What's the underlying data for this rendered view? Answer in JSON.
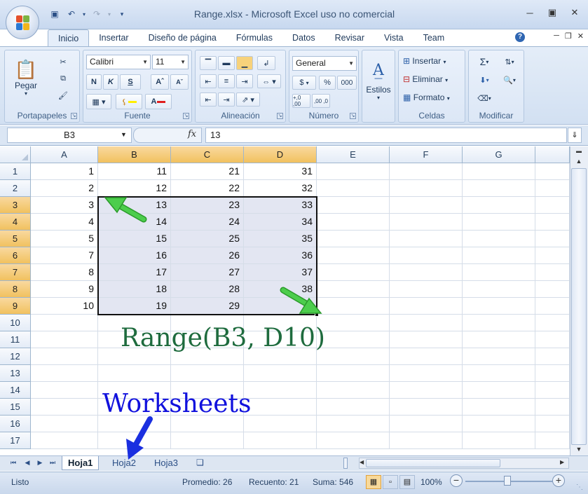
{
  "window": {
    "title": "Range.xlsx - Microsoft Excel uso no comercial"
  },
  "ribbon_tabs": [
    "Inicio",
    "Insertar",
    "Diseño de página",
    "Fórmulas",
    "Datos",
    "Revisar",
    "Vista",
    "Team"
  ],
  "ribbon": {
    "clipboard": {
      "label": "Portapapeles",
      "paste": "Pegar"
    },
    "font": {
      "label": "Fuente",
      "name": "Calibri",
      "size": "11",
      "bold": "N",
      "italic": "K",
      "underline": "S"
    },
    "alignment": {
      "label": "Alineación"
    },
    "number": {
      "label": "Número",
      "format": "General",
      "currency": "$",
      "percent": "%",
      "thousands": "000",
      "inc_decimal": "+,0 ,00",
      "dec_decimal": ",00 ,0"
    },
    "styles": {
      "label": "Estilos"
    },
    "cells": {
      "label": "Celdas",
      "insert": "Insertar",
      "delete": "Eliminar",
      "format": "Formato"
    },
    "editing": {
      "label": "Modificar"
    }
  },
  "formula_bar": {
    "name_box": "B3",
    "fx": "fx",
    "value": "13"
  },
  "columns": [
    "A",
    "B",
    "C",
    "D",
    "E",
    "F",
    "G"
  ],
  "rows": [
    {
      "n": "1",
      "A": "1",
      "B": "11",
      "C": "21",
      "D": "31"
    },
    {
      "n": "2",
      "A": "2",
      "B": "12",
      "C": "22",
      "D": "32"
    },
    {
      "n": "3",
      "A": "3",
      "B": "13",
      "C": "23",
      "D": "33"
    },
    {
      "n": "4",
      "A": "4",
      "B": "14",
      "C": "24",
      "D": "34"
    },
    {
      "n": "5",
      "A": "5",
      "B": "15",
      "C": "25",
      "D": "35"
    },
    {
      "n": "6",
      "A": "7",
      "B": "16",
      "C": "26",
      "D": "36"
    },
    {
      "n": "7",
      "A": "8",
      "B": "17",
      "C": "27",
      "D": "37"
    },
    {
      "n": "8",
      "A": "9",
      "B": "18",
      "C": "28",
      "D": "38"
    },
    {
      "n": "9",
      "A": "10",
      "B": "19",
      "C": "29",
      "D": ""
    },
    {
      "n": "10"
    },
    {
      "n": "11"
    },
    {
      "n": "12"
    },
    {
      "n": "13"
    },
    {
      "n": "14"
    },
    {
      "n": "15"
    },
    {
      "n": "16"
    },
    {
      "n": "17"
    }
  ],
  "selected_columns": [
    "B",
    "C",
    "D"
  ],
  "selected_rows": [
    "3",
    "4",
    "5",
    "6",
    "7",
    "8",
    "9"
  ],
  "sheets": [
    "Hoja1",
    "Hoja2",
    "Hoja3"
  ],
  "active_sheet": "Hoja1",
  "status": {
    "mode": "Listo",
    "average": "Promedio: 26",
    "count": "Recuento: 21",
    "sum": "Suma: 546",
    "zoom": "100%"
  },
  "annotations": {
    "range_label": "Range(B3, D10)",
    "worksheets_label": "Worksheets"
  },
  "colors": {
    "annotation_green": "#1e6b3e",
    "annotation_blue": "#1111dd",
    "arrow_green": "#3ec23e",
    "arrow_blue": "#1a2fe0",
    "selection_header": "#f6cd7d"
  }
}
